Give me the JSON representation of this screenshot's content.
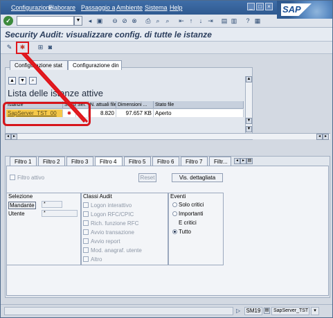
{
  "menu": [
    "Configurazione",
    "Elaborare",
    "Passaggio a",
    "Ambiente",
    "Sistema",
    "Help"
  ],
  "brand": "SAP",
  "title": "Security Audit: visualizzare config. di tutte le istanze",
  "upper_tabs": [
    "Configurazione stat",
    "Configurazione din"
  ],
  "list_title": "Lista delle istanze attive",
  "table": {
    "headers": [
      "Istanze",
      "Stato",
      "Sel.",
      "N. attuali file",
      "Dimensioni ...",
      "Stato file"
    ],
    "rows": [
      {
        "instance": "SapServer_TST_00",
        "status_icon": "red-status-icon",
        "files": "8.820",
        "size": "97.657 KB",
        "file_status": "Aperto"
      }
    ]
  },
  "filter_tabs": [
    "Filtro 1",
    "Filtro 2",
    "Filtro 3",
    "Filtro 4",
    "Filtro 5",
    "Filtro 6",
    "Filtro 7",
    "Filtr..."
  ],
  "active_filter_tab": "Filtro 4",
  "filter_active_label": "Filtro attivo",
  "reset_label": "Reset",
  "details_label": "Vis. dettagliata",
  "selection": {
    "title": "Selezione",
    "mandante_label": "Mandante",
    "mandante_value": "*",
    "utente_label": "Utente",
    "utente_value": "*"
  },
  "audit_classes": {
    "title": "Classi Audit",
    "items": [
      "Logon interattivo",
      "Logon RFC/CPIC",
      "Rich. funzione RFC",
      "Avvio transazione",
      "Avvio report",
      "Mod. anagraf. utente",
      "Altro"
    ]
  },
  "events": {
    "title": "Eventi",
    "items": [
      "Solo critici",
      "Importanti",
      "E critici",
      "Tutto"
    ],
    "selected": "Tutto"
  },
  "status": {
    "system": "SM19",
    "server": "SapServer_TST"
  },
  "colors": {
    "menubar": "#2f5a90",
    "annotation": "#e0151b",
    "selected_row": "#f5c84a"
  }
}
